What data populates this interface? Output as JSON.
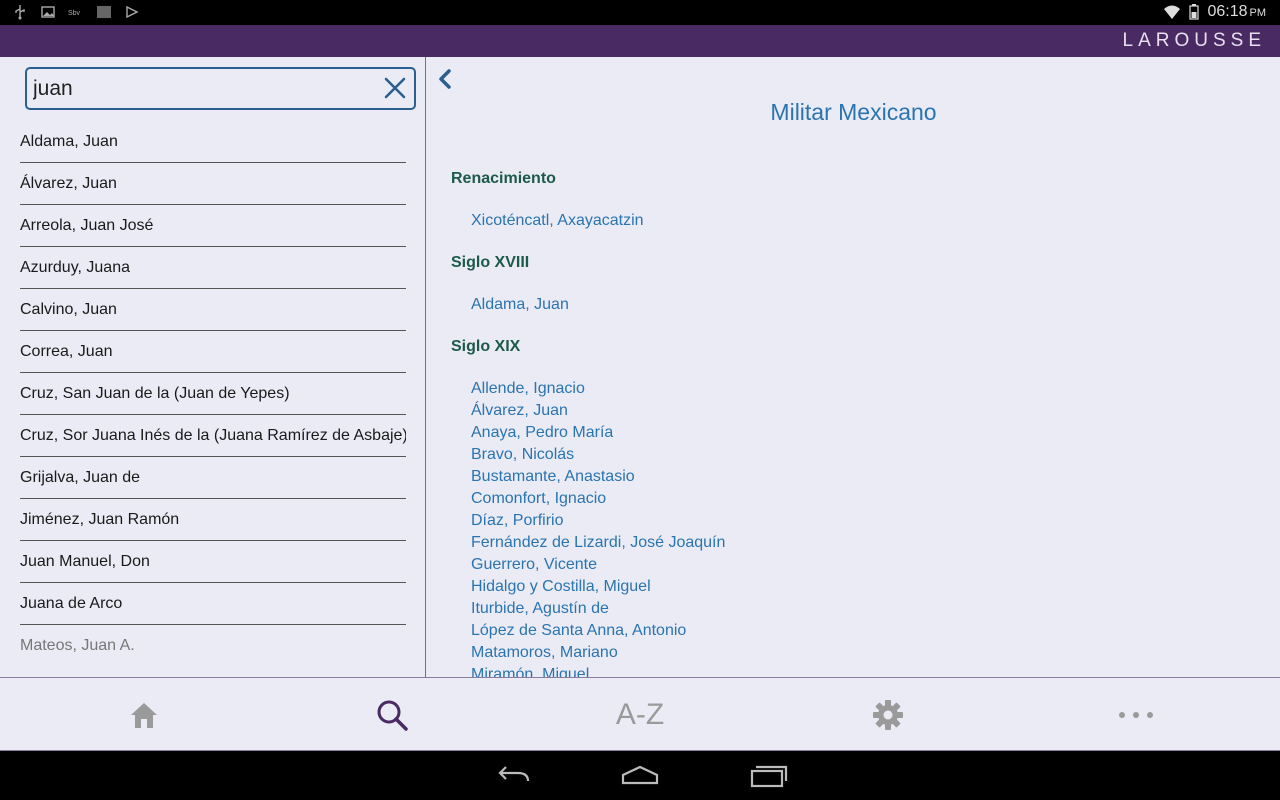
{
  "status_bar": {
    "time": "06:18",
    "ampm": "PM",
    "icons": [
      "usb-icon",
      "image-icon",
      "sim-icon",
      "barcode-icon",
      "play-store-icon",
      "wifi-icon",
      "battery-icon"
    ]
  },
  "app_bar": {
    "brand": "LAROUSSE"
  },
  "search": {
    "value": "juan",
    "placeholder": ""
  },
  "results": [
    "Aldama, Juan",
    "Álvarez, Juan",
    "Arreola, Juan José",
    "Azurduy, Juana",
    "Calvino, Juan",
    "Correa, Juan",
    "Cruz, San Juan de la (Juan de Yepes)",
    "Cruz, Sor Juana Inés de la (Juana Ramírez de Asbaje)",
    "Grijalva, Juan de",
    "Jiménez, Juan Ramón",
    "Juan Manuel, Don",
    "Juana de Arco",
    "Mateos, Juan A."
  ],
  "detail": {
    "title": "Militar Mexicano",
    "sections": [
      {
        "heading": "Renacimiento",
        "entries": [
          "Xicoténcatl, Axayacatzin"
        ]
      },
      {
        "heading": "Siglo XVIII",
        "entries": [
          "Aldama, Juan"
        ]
      },
      {
        "heading": "Siglo XIX",
        "entries": [
          "Allende, Ignacio",
          "Álvarez, Juan",
          "Anaya, Pedro María",
          "Bravo, Nicolás",
          "Bustamante, Anastasio",
          "Comonfort, Ignacio",
          "Díaz, Porfirio",
          "Fernández de Lizardi, José Joaquín",
          "Guerrero, Vicente",
          "Hidalgo y Costilla, Miguel",
          "Iturbide, Agustín de",
          "López de Santa Anna, Antonio",
          "Matamoros, Mariano",
          "Miramón, Miguel"
        ]
      }
    ]
  },
  "tabs": {
    "home_icon": "home-icon",
    "search_icon": "search-icon",
    "az_label": "A-Z",
    "settings_icon": "gear-icon",
    "more_icon": "more-icon"
  },
  "colors": {
    "app_bar": "#4a2a63",
    "accent_active": "#4a2a63",
    "link": "#2a74b0",
    "section_heading": "#1c5a4a",
    "tab_inactive": "#9a9a9a"
  }
}
